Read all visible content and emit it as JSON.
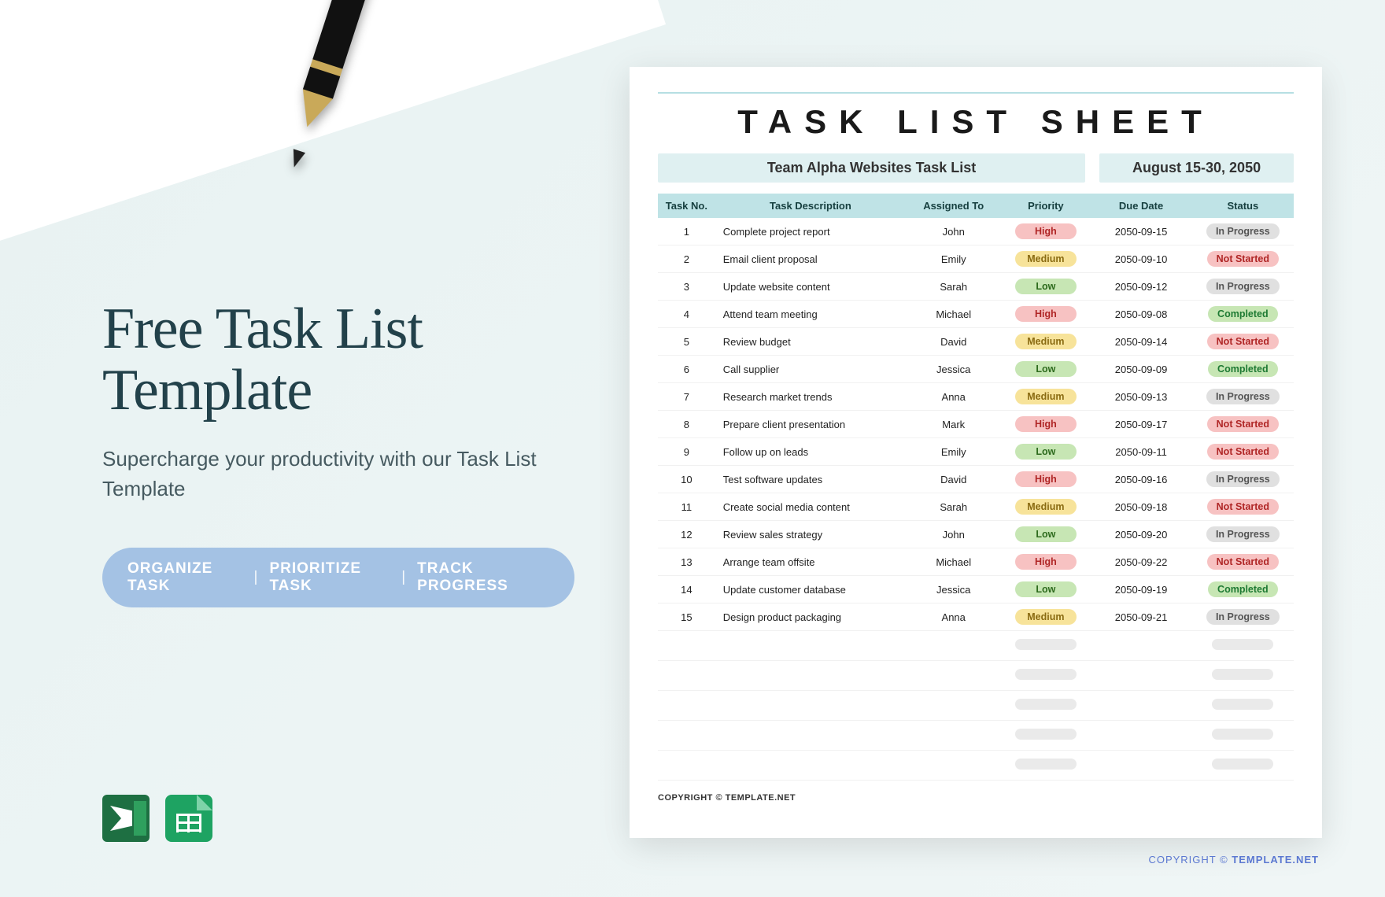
{
  "left": {
    "headline_l1": "Free Task List",
    "headline_l2": "Template",
    "sub": "Supercharge your productivity with our Task List Template",
    "pill1": "ORGANIZE TASK",
    "pill2": "PRIORITIZE TASK",
    "pill3": "TRACK PROGRESS"
  },
  "doc": {
    "title": "TASK LIST SHEET",
    "subtitle": "Team Alpha Websites Task List",
    "daterange": "August 15-30, 2050",
    "headers": {
      "c1": "Task No.",
      "c2": "Task Description",
      "c3": "Assigned To",
      "c4": "Priority",
      "c5": "Due Date",
      "c6": "Status"
    },
    "copyright_label": "COPYRIGHT © ",
    "copyright_brand": "TEMPLATE.NET"
  },
  "rows": [
    {
      "n": "1",
      "desc": "Complete project report",
      "who": "John",
      "pri": "High",
      "due": "2050-09-15",
      "st": "In Progress"
    },
    {
      "n": "2",
      "desc": "Email client proposal",
      "who": "Emily",
      "pri": "Medium",
      "due": "2050-09-10",
      "st": "Not Started"
    },
    {
      "n": "3",
      "desc": "Update website content",
      "who": "Sarah",
      "pri": "Low",
      "due": "2050-09-12",
      "st": "In Progress"
    },
    {
      "n": "4",
      "desc": "Attend team meeting",
      "who": "Michael",
      "pri": "High",
      "due": "2050-09-08",
      "st": "Completed"
    },
    {
      "n": "5",
      "desc": "Review budget",
      "who": "David",
      "pri": "Medium",
      "due": "2050-09-14",
      "st": "Not Started"
    },
    {
      "n": "6",
      "desc": "Call supplier",
      "who": "Jessica",
      "pri": "Low",
      "due": "2050-09-09",
      "st": "Completed"
    },
    {
      "n": "7",
      "desc": "Research market trends",
      "who": "Anna",
      "pri": "Medium",
      "due": "2050-09-13",
      "st": "In Progress"
    },
    {
      "n": "8",
      "desc": "Prepare client presentation",
      "who": "Mark",
      "pri": "High",
      "due": "2050-09-17",
      "st": "Not Started"
    },
    {
      "n": "9",
      "desc": "Follow up on leads",
      "who": "Emily",
      "pri": "Low",
      "due": "2050-09-11",
      "st": "Not Started"
    },
    {
      "n": "10",
      "desc": "Test software updates",
      "who": "David",
      "pri": "High",
      "due": "2050-09-16",
      "st": "In Progress"
    },
    {
      "n": "11",
      "desc": "Create social media content",
      "who": "Sarah",
      "pri": "Medium",
      "due": "2050-09-18",
      "st": "Not Started"
    },
    {
      "n": "12",
      "desc": "Review sales strategy",
      "who": "John",
      "pri": "Low",
      "due": "2050-09-20",
      "st": "In Progress"
    },
    {
      "n": "13",
      "desc": "Arrange team offsite",
      "who": "Michael",
      "pri": "High",
      "due": "2050-09-22",
      "st": "Not Started"
    },
    {
      "n": "14",
      "desc": "Update customer database",
      "who": "Jessica",
      "pri": "Low",
      "due": "2050-09-19",
      "st": "Completed"
    },
    {
      "n": "15",
      "desc": "Design product packaging",
      "who": "Anna",
      "pri": "Medium",
      "due": "2050-09-21",
      "st": "In Progress"
    }
  ],
  "empty_rows": 5,
  "outer": {
    "label": "COPYRIGHT  ©  ",
    "brand": "TEMPLATE.NET"
  }
}
